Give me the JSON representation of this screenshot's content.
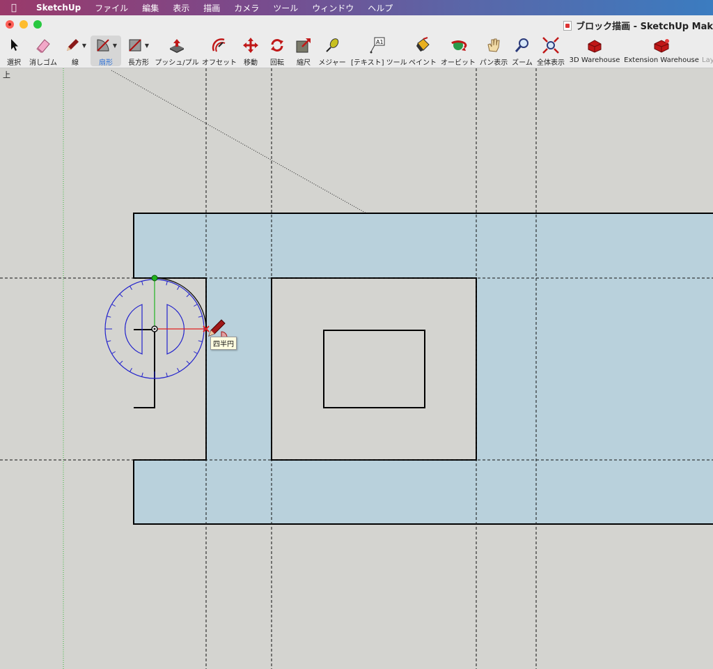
{
  "menubar": {
    "app": "SketchUp",
    "items": [
      "ファイル",
      "編集",
      "表示",
      "描画",
      "カメラ",
      "ツール",
      "ウィンドウ",
      "ヘルプ"
    ]
  },
  "window": {
    "title": "ブロック描画 - SketchUp Mak"
  },
  "toolbar": {
    "tools": [
      {
        "label": "選択",
        "icon": "select-arrow-icon"
      },
      {
        "label": "消しゴム",
        "icon": "eraser-icon"
      },
      {
        "label": "線",
        "icon": "pencil-icon"
      },
      {
        "label": "扇形",
        "icon": "pie-arc-icon"
      },
      {
        "label": "長方形",
        "icon": "rectangle-icon"
      },
      {
        "label": "プッシュ/プル",
        "icon": "push-pull-icon"
      },
      {
        "label": "オフセット",
        "icon": "offset-icon"
      },
      {
        "label": "移動",
        "icon": "move-icon"
      },
      {
        "label": "回転",
        "icon": "rotate-icon"
      },
      {
        "label": "縮尺",
        "icon": "scale-icon"
      },
      {
        "label": "メジャー",
        "icon": "tape-measure-icon"
      },
      {
        "label": "[テキスト] ツール",
        "icon": "text-tool-icon"
      },
      {
        "label": "ペイント",
        "icon": "paint-bucket-icon"
      },
      {
        "label": "オービット",
        "icon": "orbit-icon"
      },
      {
        "label": "パン表示",
        "icon": "pan-hand-icon"
      },
      {
        "label": "ズーム",
        "icon": "zoom-magnifier-icon"
      },
      {
        "label": "全体表示",
        "icon": "zoom-extents-icon"
      },
      {
        "label": "3D Warehouse",
        "icon": "3d-warehouse-icon"
      },
      {
        "label": "Extension Warehouse",
        "icon": "extension-warehouse-icon"
      },
      {
        "label": "Lay",
        "icon": ""
      }
    ],
    "text_tool_glyph": "A1",
    "active_tool": "扇形"
  },
  "canvas": {
    "view_label": "上",
    "tooltip": "四半円",
    "colors": {
      "background": "#d4d4d0",
      "face": "#b9d1dc",
      "edge": "#000000",
      "protractor": "#2222cc",
      "green_axis": "#1fb21f",
      "red_axis": "#e02020",
      "guide_line": "#000000"
    }
  }
}
